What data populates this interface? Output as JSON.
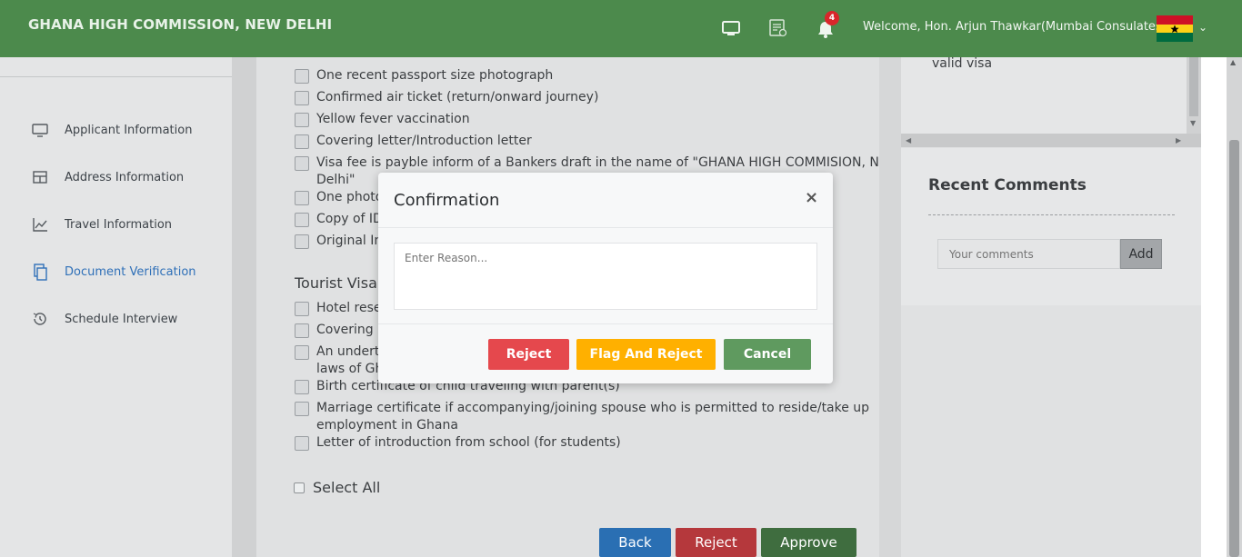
{
  "header": {
    "title": "GHANA HIGH COMMISSION, NEW DELHI",
    "icons": [
      "monitor-icon",
      "document-settings-icon",
      "bell-icon"
    ],
    "notification_count": "4",
    "welcome": "Welcome, Hon. Arjun Thawkar(Mumbai Consulates)",
    "flag": "ghana-flag",
    "colors": {
      "header_bg": "#4c8a4c",
      "badge": "#d9262b"
    }
  },
  "sidebar": {
    "items": [
      {
        "label": "Applicant Information",
        "icon": "monitor-icon",
        "active": false
      },
      {
        "label": "Address Information",
        "icon": "table-icon",
        "active": false
      },
      {
        "label": "Travel Information",
        "icon": "line-chart-icon",
        "active": false
      },
      {
        "label": "Document Verification",
        "icon": "copy-icon",
        "active": true
      },
      {
        "label": "Schedule Interview",
        "icon": "history-icon",
        "active": false
      }
    ]
  },
  "documents": {
    "general": [
      "One recent passport size photograph",
      "Confirmed air ticket (return/onward journey)",
      "Yellow fever vaccination",
      "Covering letter/Introduction letter",
      "Visa fee is payble inform of a Bankers draft in the name of \"GHANA HIGH COMMISION, New",
      "Delhi\"",
      "One photo",
      "Copy of ID",
      "Original Inv"
    ],
    "tourist_title": "Tourist Visa R",
    "tourist": [
      "Hotel reser",
      "Covering le",
      "An underta",
      "laws of Gha",
      "Birth certificate of child traveling with parent(s)",
      "Marriage certificate if accompanying/joining spouse who is permitted to reside/take up",
      "employment in Ghana",
      "Letter of introduction from school (for students)"
    ],
    "select_all": "Select All"
  },
  "actions": {
    "back": "Back",
    "reject": "Reject",
    "approve": "Approve"
  },
  "right": {
    "visa_text": "valid visa",
    "comments_title": "Recent Comments",
    "comment_placeholder": "Your comments",
    "add_label": "Add"
  },
  "modal": {
    "title": "Confirmation",
    "close": "×",
    "reason_placeholder": "Enter Reason...",
    "buttons": {
      "reject": "Reject",
      "flag_reject": "Flag And Reject",
      "cancel": "Cancel"
    },
    "colors": {
      "reject": "#e5484d",
      "flag_reject": "#ffb000",
      "cancel": "#5f9a5f"
    }
  }
}
